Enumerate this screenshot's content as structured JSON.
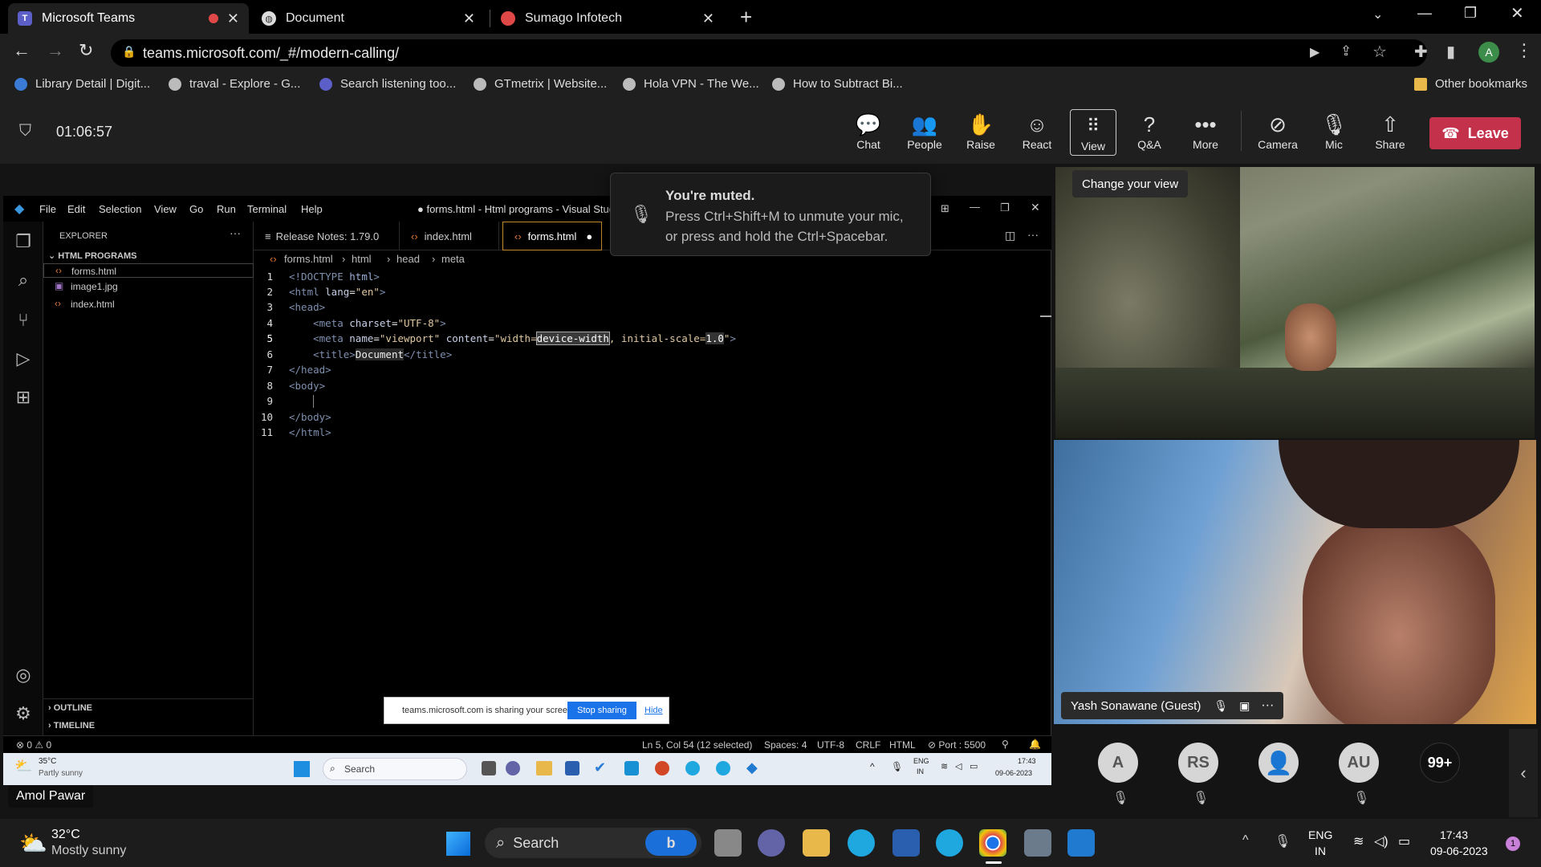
{
  "browser": {
    "tabs": [
      {
        "title": "Microsoft Teams",
        "active": true
      },
      {
        "title": "Document",
        "active": false
      },
      {
        "title": "Sumago Infotech",
        "active": false
      }
    ],
    "url": "teams.microsoft.com/_#/modern-calling/",
    "bookmarks": [
      "Library Detail | Digit...",
      "traval - Explore - G...",
      "Search listening too...",
      "GTmetrix | Website...",
      "Hola VPN - The We...",
      "How to Subtract Bi..."
    ],
    "other_bookmarks": "Other bookmarks",
    "profile_initial": "A"
  },
  "teams": {
    "timer": "01:06:57",
    "buttons": [
      "Chat",
      "People",
      "Raise",
      "React",
      "View",
      "Q&A",
      "More",
      "Camera",
      "Mic",
      "Share"
    ],
    "leave": "Leave",
    "tooltip": "Change your view",
    "toast": {
      "title": "You're muted.",
      "line1": "Press Ctrl+Shift+M to unmute your mic,",
      "line2": "or press and hold the Ctrl+Spacebar."
    },
    "participant1": "Yash Sonawane (Guest)",
    "avatars": [
      "A",
      "RS",
      "",
      "AU",
      "99+"
    ],
    "presenter": "Amol Pawar"
  },
  "vscode": {
    "menu": [
      "File",
      "Edit",
      "Selection",
      "View",
      "Go",
      "Run",
      "Terminal",
      "Help"
    ],
    "title": "● forms.html - Html programs - Visual Studio",
    "explorer_label": "EXPLORER",
    "folder": "HTML PROGRAMS",
    "files": [
      "forms.html",
      "image1.jpg",
      "index.html"
    ],
    "outline": "OUTLINE",
    "timeline": "TIMELINE",
    "tabs": [
      "Release Notes: 1.79.0",
      "index.html",
      "forms.html"
    ],
    "breadcrumb": [
      "forms.html",
      "html",
      "head",
      "meta"
    ],
    "status": {
      "problems": "⊗ 0 ⚠ 0",
      "position": "Ln 5, Col 54 (12 selected)",
      "spaces": "Spaces: 4",
      "encoding": "UTF-8",
      "eol": "CRLF",
      "lang": "HTML",
      "port": "⊘ Port : 5500"
    },
    "share_notice": "teams.microsoft.com is sharing your screen.",
    "stop_sharing": "Stop sharing",
    "hide": "Hide"
  },
  "inner_taskbar": {
    "temp": "35°C",
    "weather": "Partly sunny",
    "search": "Search",
    "lang1": "ENG",
    "lang2": "IN",
    "time": "17:43",
    "date": "09-06-2023"
  },
  "taskbar": {
    "temp": "32°C",
    "weather": "Mostly sunny",
    "search": "Search",
    "lang1": "ENG",
    "lang2": "IN",
    "time": "17:43",
    "date": "09-06-2023",
    "notif": "1"
  }
}
